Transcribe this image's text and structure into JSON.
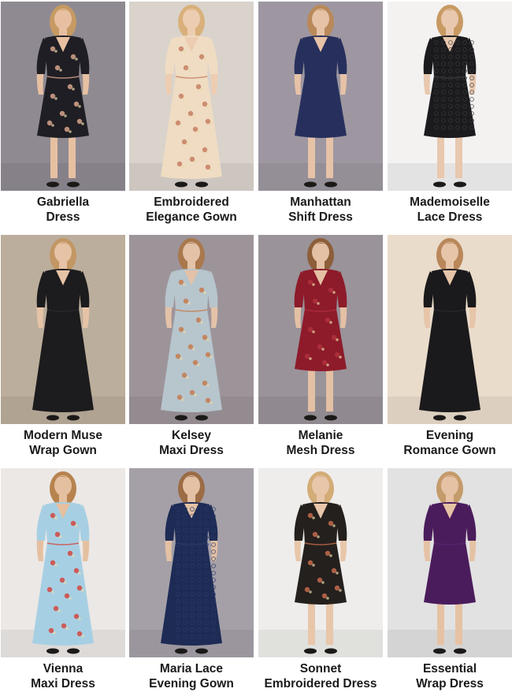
{
  "products": [
    {
      "line1": "Gabriella",
      "line2": "Dress",
      "bg": "#8f8a92",
      "dress": "#1f1e24",
      "accent": "#d7a38b",
      "skin": "#e7c0a2",
      "hair": "#c69a62",
      "style": "floral-short"
    },
    {
      "line1": "Embroidered",
      "line2": "Elegance Gown",
      "bg": "#d9d3cc",
      "dress": "#efdcc2",
      "accent": "#c77e62",
      "skin": "#edcdb2",
      "hair": "#d9b07b",
      "style": "floral-long"
    },
    {
      "line1": "Manhattan",
      "line2": "Shift Dress",
      "bg": "#9e97a1",
      "dress": "#27305d",
      "accent": "#27305d",
      "skin": "#e6c2a7",
      "hair": "#b9895a",
      "style": "plain-short"
    },
    {
      "line1": "Mademoiselle",
      "line2": "Lace Dress",
      "bg": "#f3f2f1",
      "dress": "#1b1a1d",
      "accent": "#3c3a3d",
      "skin": "#e8c8ae",
      "hair": "#c89a62",
      "style": "lace-short"
    },
    {
      "line1": "Modern Muse",
      "line2": "Wrap Gown",
      "bg": "#bcae9c",
      "dress": "#1c1b1d",
      "accent": "#2d2b2e",
      "skin": "#e6c3a6",
      "hair": "#c29764",
      "style": "plain-long"
    },
    {
      "line1": "Kelsey",
      "line2": "Maxi Dress",
      "bg": "#9d949a",
      "dress": "#b7c5cd",
      "accent": "#c67a4e",
      "skin": "#e3c2a8",
      "hair": "#a9784c",
      "style": "floral-long"
    },
    {
      "line1": "Melanie",
      "line2": "Mesh Dress",
      "bg": "#9a939a",
      "dress": "#8d1b2a",
      "accent": "#b0303d",
      "skin": "#e4c0a4",
      "hair": "#8c5f3a",
      "style": "floral-short"
    },
    {
      "line1": "Evening",
      "line2": "Romance Gown",
      "bg": "#eadccb",
      "dress": "#1a191b",
      "accent": "#2c2a2c",
      "skin": "#e7c5a9",
      "hair": "#b9875a",
      "style": "plain-long"
    },
    {
      "line1": "Vienna",
      "line2": "Maxi Dress",
      "bg": "#ebe8e6",
      "dress": "#a7cfe3",
      "accent": "#d2473f",
      "skin": "#e5c0a0",
      "hair": "#b7834f",
      "style": "floral-long"
    },
    {
      "line1": "Maria Lace",
      "line2": "Evening Gown",
      "bg": "#a5a0a8",
      "dress": "#1d2b55",
      "accent": "#2b3a68",
      "skin": "#e4c1a4",
      "hair": "#9b6c45",
      "style": "lace-long"
    },
    {
      "line1": "Sonnet",
      "line2": "Embroidered Dress",
      "bg": "#eeedeb",
      "dress": "#24201d",
      "accent": "#c56a4c",
      "skin": "#e8c6aa",
      "hair": "#d3ac77",
      "style": "floral-short"
    },
    {
      "line1": "Essential",
      "line2": "Wrap Dress",
      "bg": "#e2e2e2",
      "dress": "#4b1c5c",
      "accent": "#5a2670",
      "skin": "#e6c2a5",
      "hair": "#c49b6a",
      "style": "plain-short"
    }
  ]
}
